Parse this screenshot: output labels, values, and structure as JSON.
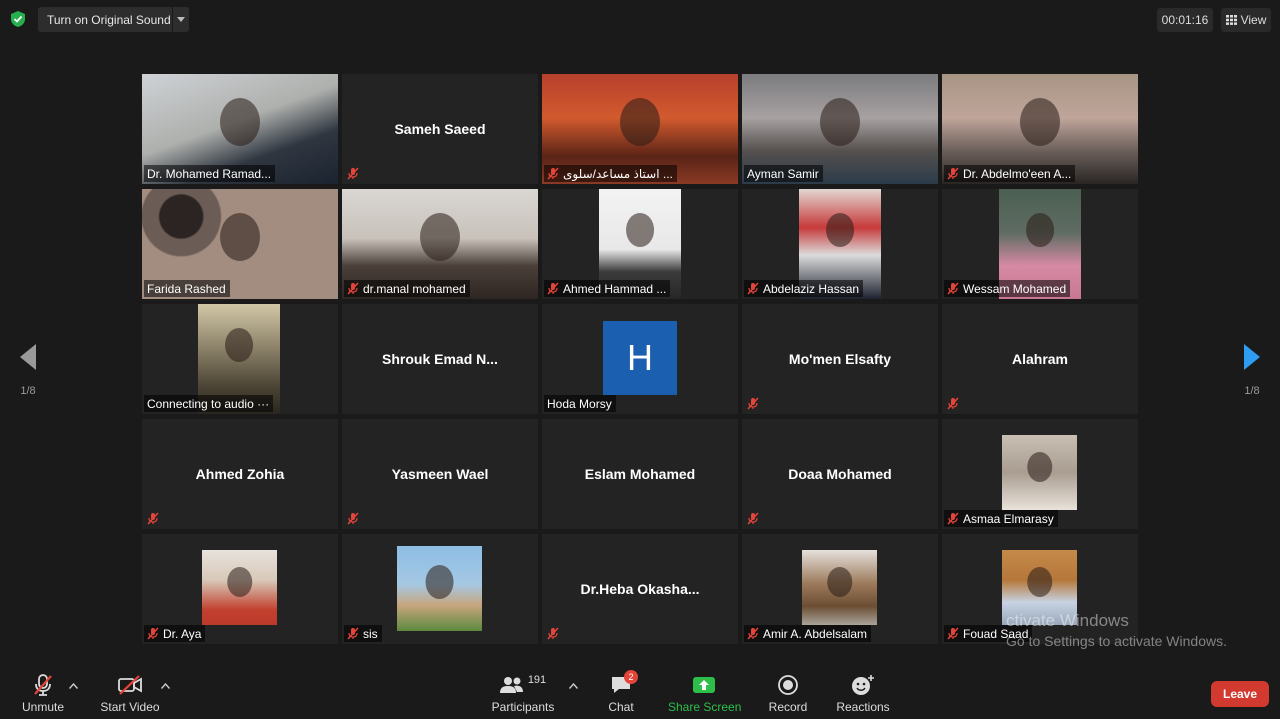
{
  "top_bar": {
    "original_sound_label": "Turn on Original Sound",
    "timer": "00:01:16",
    "view_label": "View"
  },
  "nav": {
    "page_left": "1/8",
    "page_right": "1/8"
  },
  "tiles": [
    {
      "name": "Dr. Mohamed Ramad...",
      "type": "video",
      "muted": false
    },
    {
      "name": "Sameh Saeed",
      "type": "name",
      "muted": true
    },
    {
      "name": "استاذ مساعد/سلوى ...",
      "type": "video",
      "muted": true
    },
    {
      "name": "Ayman Samir",
      "type": "video",
      "muted": false,
      "active": true
    },
    {
      "name": "Dr. Abdelmo'een A...",
      "type": "video",
      "muted": true
    },
    {
      "name": "Farida Rashed",
      "type": "video",
      "muted": false
    },
    {
      "name": "dr.manal mohamed",
      "type": "video",
      "muted": true
    },
    {
      "name": "Ahmed Hammad ...",
      "type": "photo",
      "muted": true
    },
    {
      "name": "Abdelaziz Hassan",
      "type": "photo",
      "muted": true
    },
    {
      "name": "Wessam Mohamed",
      "type": "photo",
      "muted": true
    },
    {
      "name": "Connecting to audio ···",
      "type": "photo",
      "muted": false
    },
    {
      "name": "Shrouk  Emad  N...",
      "type": "name",
      "muted": false
    },
    {
      "name": "Hoda Morsy",
      "type": "avatar",
      "initial": "H",
      "muted": false
    },
    {
      "name": "Mo'men Elsafty",
      "type": "name",
      "muted": true
    },
    {
      "name": "Alahram",
      "type": "name",
      "muted": true
    },
    {
      "name": "Ahmed Zohia",
      "type": "name",
      "muted": true
    },
    {
      "name": "Yasmeen Wael",
      "type": "name",
      "muted": true
    },
    {
      "name": "Eslam Mohamed",
      "type": "name",
      "muted": false
    },
    {
      "name": "Doaa Mohamed",
      "type": "name",
      "muted": true
    },
    {
      "name": "Asmaa Elmarasy",
      "type": "photo",
      "muted": true
    },
    {
      "name": "Dr. Aya",
      "type": "photo",
      "muted": true
    },
    {
      "name": "sis",
      "type": "photo",
      "muted": true
    },
    {
      "name": "Dr.Heba  Okasha...",
      "type": "name",
      "muted": true
    },
    {
      "name": "Amir A. Abdelsalam",
      "type": "photo",
      "muted": true
    },
    {
      "name": "Fouad Saad",
      "type": "photo",
      "muted": true
    }
  ],
  "toolbar": {
    "unmute": "Unmute",
    "start_video": "Start Video",
    "participants": "Participants",
    "participant_count": "191",
    "chat": "Chat",
    "chat_badge": "2",
    "share_screen": "Share Screen",
    "record": "Record",
    "reactions": "Reactions",
    "leave": "Leave"
  },
  "watermark": {
    "title": "ctivate Windows",
    "subtitle": "Go to Settings to activate Windows."
  },
  "colors": {
    "background": "#1a1a1a",
    "tile": "#232323",
    "active_border": "#d7e26a",
    "muted_red": "#e5443a",
    "share_green": "#2dbf4a",
    "leave_red": "#d33a2f",
    "avatar_blue": "#1a5fb0"
  }
}
